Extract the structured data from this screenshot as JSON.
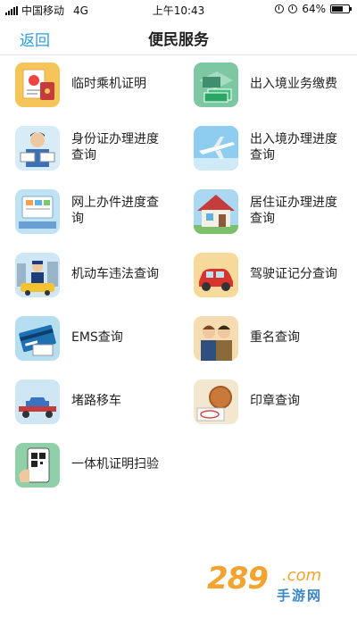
{
  "status_bar": {
    "carrier": "中国移动",
    "network": "4G",
    "time": "上午10:43",
    "battery": "64%",
    "battery_level": 0.64
  },
  "nav": {
    "back_label": "返回",
    "title": "便民服务"
  },
  "services": [
    {
      "label": "临时乘机证明",
      "icon": "boarding-certificate-icon"
    },
    {
      "label": "出入境业务缴费",
      "icon": "payment-icon"
    },
    {
      "label": "身份证办理进度查询",
      "icon": "id-card-icon"
    },
    {
      "label": "出入境办理进度查询",
      "icon": "airplane-icon"
    },
    {
      "label": "网上办件进度查询",
      "icon": "online-office-icon"
    },
    {
      "label": "居住证办理进度查询",
      "icon": "house-icon"
    },
    {
      "label": "机动车违法查询",
      "icon": "traffic-police-icon"
    },
    {
      "label": "驾驶证记分查询",
      "icon": "car-icon"
    },
    {
      "label": "EMS查询",
      "icon": "ems-card-icon"
    },
    {
      "label": "重名查询",
      "icon": "people-icon"
    },
    {
      "label": "堵路移车",
      "icon": "tow-truck-icon"
    },
    {
      "label": "印章查询",
      "icon": "seal-icon"
    },
    {
      "label": "一体机证明扫验",
      "icon": "qr-scan-icon"
    }
  ],
  "watermark": {
    "number": "289",
    "domain": ".com",
    "text": "手游网"
  },
  "colors": {
    "accent": "#2a9ce0",
    "watermark_orange": "#f3a32f",
    "watermark_blue": "#3b86c7"
  }
}
